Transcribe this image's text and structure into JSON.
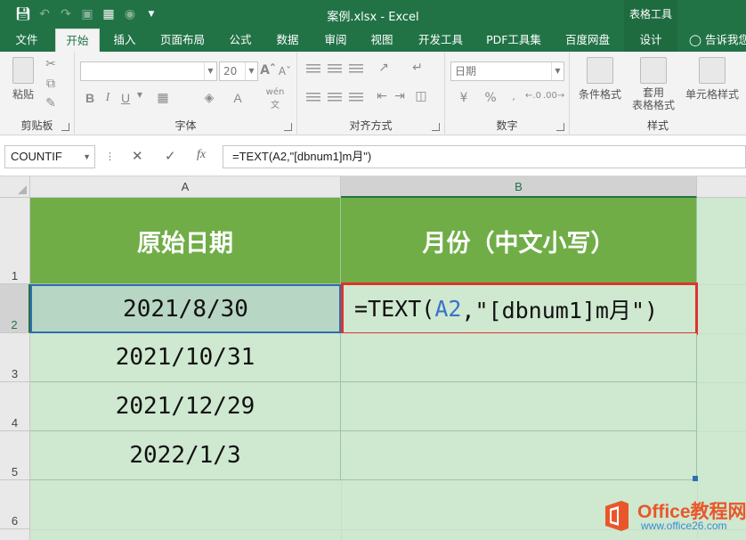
{
  "window": {
    "title": "案例.xlsx - Excel",
    "context_tab_group": "表格工具"
  },
  "ribbon": {
    "tabs": [
      {
        "label": "文件"
      },
      {
        "label": "开始"
      },
      {
        "label": "插入"
      },
      {
        "label": "页面布局"
      },
      {
        "label": "公式"
      },
      {
        "label": "数据"
      },
      {
        "label": "审阅"
      },
      {
        "label": "视图"
      },
      {
        "label": "开发工具"
      },
      {
        "label": "PDF工具集"
      },
      {
        "label": "百度网盘"
      },
      {
        "label": "设计"
      }
    ],
    "active_tab": "开始",
    "tell_me": "告诉我您",
    "clipboard": {
      "paste_label": "粘贴",
      "group_label": "剪贴板"
    },
    "font": {
      "font_name": "",
      "font_size": "20",
      "group_label": "字体",
      "wen_label": "wén"
    },
    "alignment": {
      "group_label": "对齐方式"
    },
    "number": {
      "format_value": "日期",
      "group_label": "数字"
    },
    "styles": {
      "conditional_label": "条件格式",
      "table_label_1": "套用",
      "table_label_2": "表格格式",
      "cell_styles_label": "单元格样式",
      "group_label": "样式"
    }
  },
  "formula_bar": {
    "name_box": "COUNTIF",
    "fx": "fx",
    "formula": "=TEXT(A2,\"[dbnum1]m月\")"
  },
  "grid": {
    "columns": [
      "A",
      "B"
    ],
    "rows": [
      "1",
      "2",
      "3",
      "4",
      "5",
      "6"
    ],
    "header_row": {
      "a": "原始日期",
      "b": "月份（中文小写）"
    },
    "data_rows": [
      {
        "a": "2021/8/30",
        "b_editing": {
          "prefix": "=TEXT(",
          "ref": "A2",
          "suffix": ",\"[dbnum1]m月\")"
        }
      },
      {
        "a": "2021/10/31",
        "b": ""
      },
      {
        "a": "2021/12/29",
        "b": ""
      },
      {
        "a": "2022/1/3",
        "b": ""
      }
    ],
    "active_cell": "B2"
  },
  "watermark": {
    "line1": "Office教程网",
    "line2": "www.office26.com"
  },
  "colors": {
    "excel_green": "#217346",
    "header_fill": "#70ad47",
    "data_fill": "#cfe8d0",
    "edit_border": "#e0322d",
    "ref_blue": "#3a73c9"
  }
}
